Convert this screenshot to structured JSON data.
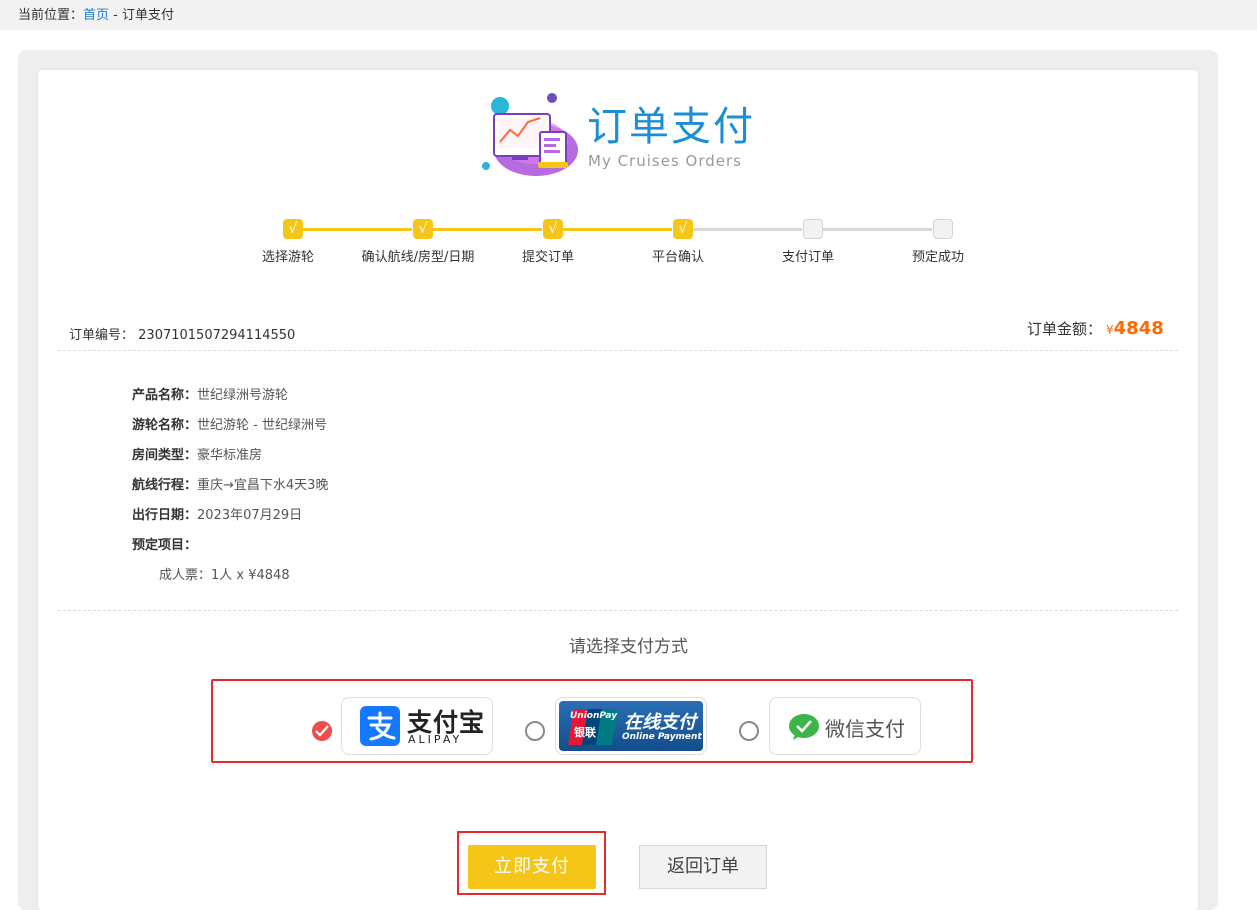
{
  "breadcrumb": {
    "prefix": "当前位置：",
    "home": "首页",
    "sep": " - ",
    "current": "订单支付"
  },
  "header": {
    "title_cn": "订单支付",
    "title_en": "My Cruises Orders"
  },
  "steps": [
    {
      "label": "选择游轮",
      "done": true,
      "check": "√"
    },
    {
      "label": "确认航线/房型/日期",
      "done": true,
      "check": "√"
    },
    {
      "label": "提交订单",
      "done": true,
      "check": "√"
    },
    {
      "label": "平台确认",
      "done": true,
      "check": "√"
    },
    {
      "label": "支付订单",
      "done": false,
      "check": ""
    },
    {
      "label": "预定成功",
      "done": false,
      "check": ""
    }
  ],
  "order": {
    "no_label": "订单编号：",
    "no_value": "2307101507294114550",
    "amount_label": "订单金额：",
    "currency": "¥",
    "amount": "4848"
  },
  "details": [
    {
      "k": "产品名称：",
      "v": "世纪绿洲号游轮"
    },
    {
      "k": "游轮名称：",
      "v": "世纪游轮 - 世纪绿洲号"
    },
    {
      "k": "房间类型：",
      "v": "豪华标准房"
    },
    {
      "k": "航线行程：",
      "v": "重庆→宜昌下水4天3晚"
    },
    {
      "k": "出行日期：",
      "v": "2023年07月29日"
    },
    {
      "k": "预定项目：",
      "v": ""
    }
  ],
  "ticket_line": "成人票：1人 x ¥4848",
  "payment": {
    "prompt": "请选择支付方式",
    "selected": "alipay",
    "methods": [
      {
        "id": "alipay",
        "icon": "alipay-icon",
        "cn": "支付宝",
        "en": "ALIPAY",
        "color": "#1677ff"
      },
      {
        "id": "unionpay",
        "icon": "unionpay-icon",
        "brand": "UnionPay",
        "brand_cn": "银联",
        "cn": "在线支付",
        "en": "Online Payment",
        "color": "#1a5a9c"
      },
      {
        "id": "wechat",
        "icon": "wechat-icon",
        "cn": "微信支付",
        "color": "#3bb54a"
      }
    ]
  },
  "buttons": {
    "pay": "立即支付",
    "back": "返回订单"
  },
  "colors": {
    "accent_yellow": "#f5c518",
    "price_orange": "#ff6a00",
    "highlight_red": "#e52b2b",
    "title_blue": "#1a8fd6"
  }
}
